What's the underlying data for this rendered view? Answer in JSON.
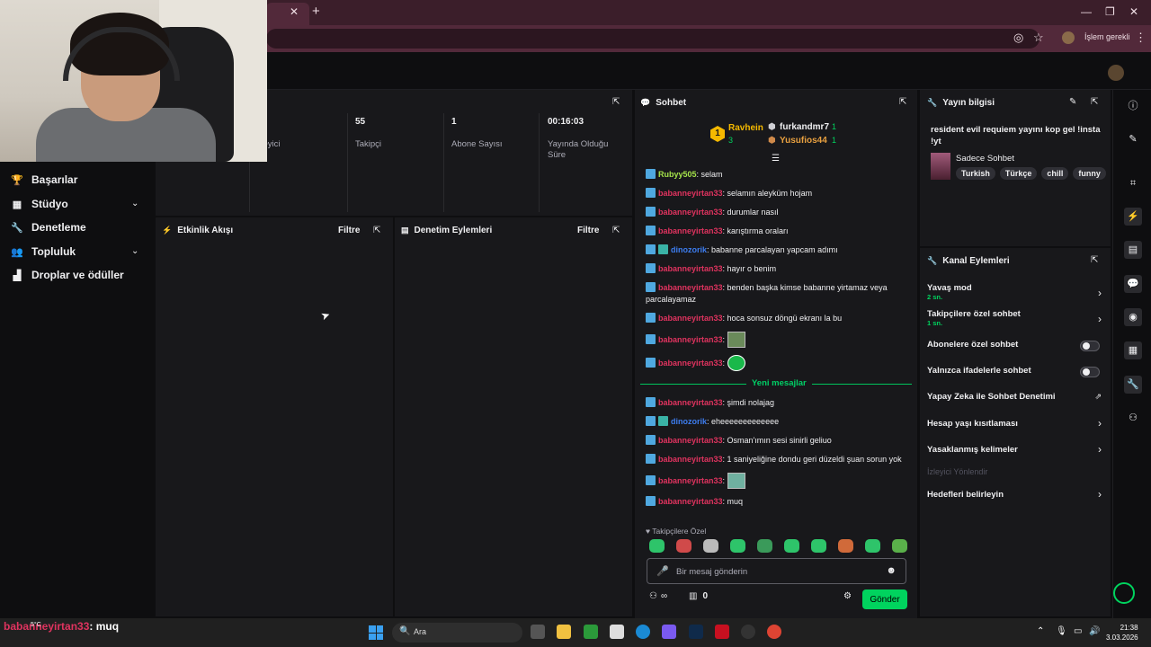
{
  "browser": {
    "action_needed": "İşlem gerekli"
  },
  "nav": {
    "items": [
      {
        "label": "Başarılar",
        "icon": "trophy-icon"
      },
      {
        "label": "Stüdyo",
        "icon": "studio-icon"
      },
      {
        "label": "Denetleme",
        "icon": "wrench-icon"
      },
      {
        "label": "Topluluk",
        "icon": "community-icon"
      },
      {
        "label": "Droplar ve ödüller",
        "icon": "gift-icon"
      }
    ]
  },
  "stats": {
    "viewers_label": "İzleyici",
    "followers_value": "55",
    "followers_label": "Takipçi",
    "subs_value": "1",
    "subs_label": "Abone Sayısı",
    "uptime_value": "00:16:03",
    "uptime_label": "Yayında Olduğu Süre"
  },
  "activity": {
    "title": "Etkinlik Akışı",
    "filter": "Filtre"
  },
  "modactions": {
    "title": "Denetim Eylemleri",
    "filter": "Filtre"
  },
  "chat": {
    "title": "Sohbet",
    "leaderboard": {
      "first": {
        "rank": "1",
        "name": "Ravhein",
        "count": "3"
      },
      "second": {
        "name": "furkandmr7",
        "count": "1"
      },
      "third": {
        "name": "Yusufios44",
        "count": "1"
      }
    },
    "messages": [
      {
        "user": "Rubyy505",
        "color": "green",
        "text": ": selam"
      },
      {
        "user": "babanneyirtan33",
        "color": "red",
        "text": ": selamın aleyküm hojam"
      },
      {
        "user": "babanneyirtan33",
        "color": "red",
        "text": ": durumlar nasıl"
      },
      {
        "user": "babanneyirtan33",
        "color": "red",
        "text": ": karıştırma oraları"
      },
      {
        "user": "dinozorik",
        "color": "blue",
        "text": ": babanne parcalayan yapcam adımı"
      },
      {
        "user": "babanneyirtan33",
        "color": "red",
        "text": ": hayır o benim"
      },
      {
        "user": "babanneyirtan33",
        "color": "red",
        "text": ": benden başka kimse babanne yirtamaz veya parcalayamaz"
      },
      {
        "user": "babanneyirtan33",
        "color": "red",
        "text": ": hoca sonsuz döngü ekranı la bu"
      },
      {
        "user": "babanneyirtan33",
        "color": "red",
        "text": ":"
      },
      {
        "user": "babanneyirtan33",
        "color": "red",
        "text": ":"
      }
    ],
    "new_messages": "Yeni mesajlar",
    "messages_new": [
      {
        "user": "babanneyirtan33",
        "color": "red",
        "text": ": şimdi nolajag"
      },
      {
        "user": "dinozorik",
        "color": "blue",
        "text": ": eheeeeeeeeeeeee"
      },
      {
        "user": "babanneyirtan33",
        "color": "red",
        "text": ": Osman'ımın sesi sinirli geliuo"
      },
      {
        "user": "babanneyirtan33",
        "color": "red",
        "text": ": 1 saniyeliğine dondu geri düzeldi şuan sorun yok"
      },
      {
        "user": "babanneyirtan33",
        "color": "red",
        "text": ":"
      },
      {
        "user": "babanneyirtan33",
        "color": "red",
        "text": ": muq"
      }
    ],
    "followers_only": "Takipçilere Özel",
    "input_placeholder": "Bir mesaj gönderin",
    "points": "0",
    "send": "Gönder"
  },
  "streaminfo": {
    "title": "Yayın bilgisi",
    "stream_title": "resident evil requiem yayını kop gel !insta !yt",
    "category": "Sadece Sohbet",
    "tags": [
      "Turkish",
      "Türkçe",
      "chill",
      "funny"
    ]
  },
  "chanactions": {
    "title": "Kanal Eylemleri",
    "slow_mode": "Yavaş mod",
    "slow_mode_sub": "2 sn.",
    "followers_chat": "Takipçilere özel sohbet",
    "followers_chat_sub": "1 sn.",
    "subs_chat": "Abonelere özel sohbet",
    "emote_chat": "Yalnızca ifadelerle sohbet",
    "ai_mod": "Yapay Zeka ile Sohbet Denetimi",
    "account_age": "Hesap yaşı kısıtlaması",
    "banned_words": "Yasaklanmış kelimeler",
    "viewer_directed": "İzleyici Yönlendir",
    "set_goals": "Hedefleri belirleyin"
  },
  "taskbar": {
    "ticker_user": "babanneyirtan33",
    "ticker_text": ": muq",
    "temp": "5°C",
    "search": "Ara",
    "time": "21:38",
    "date": "3.03.2026"
  }
}
